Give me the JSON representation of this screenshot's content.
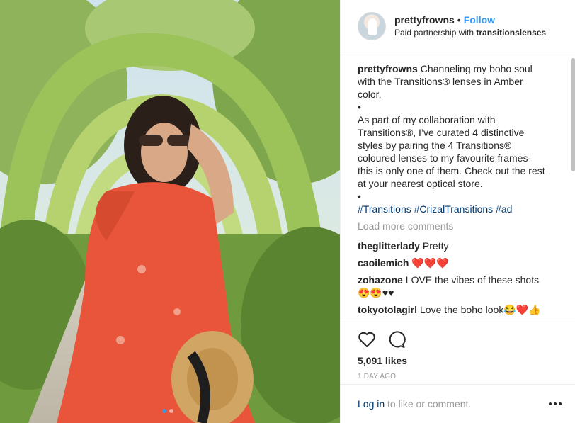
{
  "header": {
    "username": "prettyfrowns",
    "separator": "•",
    "follow_label": "Follow",
    "partnership_prefix": "Paid partnership with",
    "partner": "transitionslenses"
  },
  "caption": {
    "username": "prettyfrowns",
    "line1": "Channeling my boho soul with the Transitions® lenses in Amber color.",
    "bullet1": "•",
    "line2": "As part of my collaboration with Transitions®, I’ve curated 4 distinctive styles by pairing the 4 Transitions® coloured lenses to my favourite frames- this is only one of them. Check out the rest at your nearest optical store.",
    "bullet2": "•",
    "hashtags": "#Transitions #CrizalTransitions #ad"
  },
  "load_more_label": "Load more comments",
  "comments": [
    {
      "username": "theglitterlady",
      "text": "Pretty"
    },
    {
      "username": "caoilemich",
      "text": "❤️❤️❤️"
    },
    {
      "username": "zohazone",
      "text": "LOVE the vibes of these shots 😍😍♥♥"
    },
    {
      "username": "tokyotolagirl",
      "text": "Love the boho look😂❤️👍"
    }
  ],
  "actions": {
    "like_icon": "heart-icon",
    "comment_icon": "speech-bubble-icon",
    "likes": "5,091 likes",
    "date": "1 DAY AGO"
  },
  "footer": {
    "login_link": "Log in",
    "login_rest": " to like or comment.",
    "more_icon": "ellipsis-icon"
  },
  "carousel": {
    "count": 2,
    "active_index": 0
  },
  "colors": {
    "accent": "#3897f0",
    "link": "#003569",
    "muted": "#999999",
    "text": "#262626",
    "dress": "#e8553a"
  }
}
